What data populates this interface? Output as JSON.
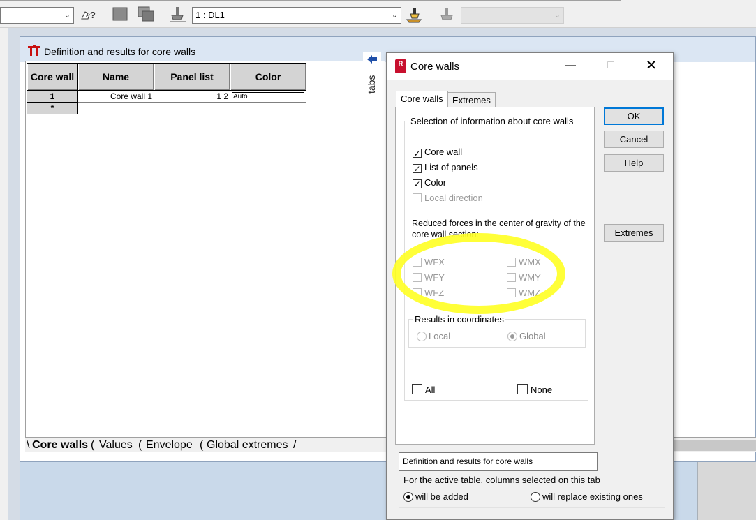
{
  "toolbar": {
    "case_combo": "1 : DL1",
    "left_combo_value": "",
    "right_combo_value": "",
    "help_glyph": "?"
  },
  "main_window": {
    "title": "Definition and results for core walls",
    "tabs_strip_label": "tabs",
    "grid": {
      "columns": [
        "Core wall",
        "Name",
        "Panel list",
        "Color"
      ],
      "rows": [
        {
          "core_wall": "1",
          "name": "Core wall 1",
          "panel_list": "1 2",
          "color": "Auto"
        },
        {
          "core_wall": "*",
          "name": "",
          "panel_list": "",
          "color": ""
        }
      ]
    },
    "bottom_tabs": [
      "Core walls",
      "Values",
      "Envelope",
      "Global extremes"
    ]
  },
  "dialog": {
    "title": "Core walls",
    "logo_letter": "R",
    "tabs": [
      "Core walls",
      "Extremes"
    ],
    "selection_group": "Selection of information about core walls",
    "checkboxes": [
      {
        "label": "Core wall",
        "checked": true,
        "enabled": true
      },
      {
        "label": "List of panels",
        "checked": true,
        "enabled": true
      },
      {
        "label": "Color",
        "checked": true,
        "enabled": true
      },
      {
        "label": "Local direction",
        "checked": false,
        "enabled": false
      }
    ],
    "forces_caption": "Reduced forces in the center of gravity of the core wall section:",
    "forces": [
      "WFX",
      "WFY",
      "WFZ",
      "WMX",
      "WMY",
      "WMZ"
    ],
    "results_group": "Results in coordinates",
    "results_options": [
      {
        "label": "Local",
        "selected": false
      },
      {
        "label": "Global",
        "selected": true
      }
    ],
    "all_label": "All",
    "none_label": "None",
    "buttons": {
      "ok": "OK",
      "cancel": "Cancel",
      "help": "Help",
      "extremes": "Extremes"
    },
    "table_name": "Definition and results for core walls",
    "active_table_group": "For the active table, columns selected on this tab",
    "active_table_options": [
      {
        "label": "will be added",
        "selected": true
      },
      {
        "label": "will replace existing ones",
        "selected": false
      }
    ],
    "highlight_color": "#ffff22"
  }
}
